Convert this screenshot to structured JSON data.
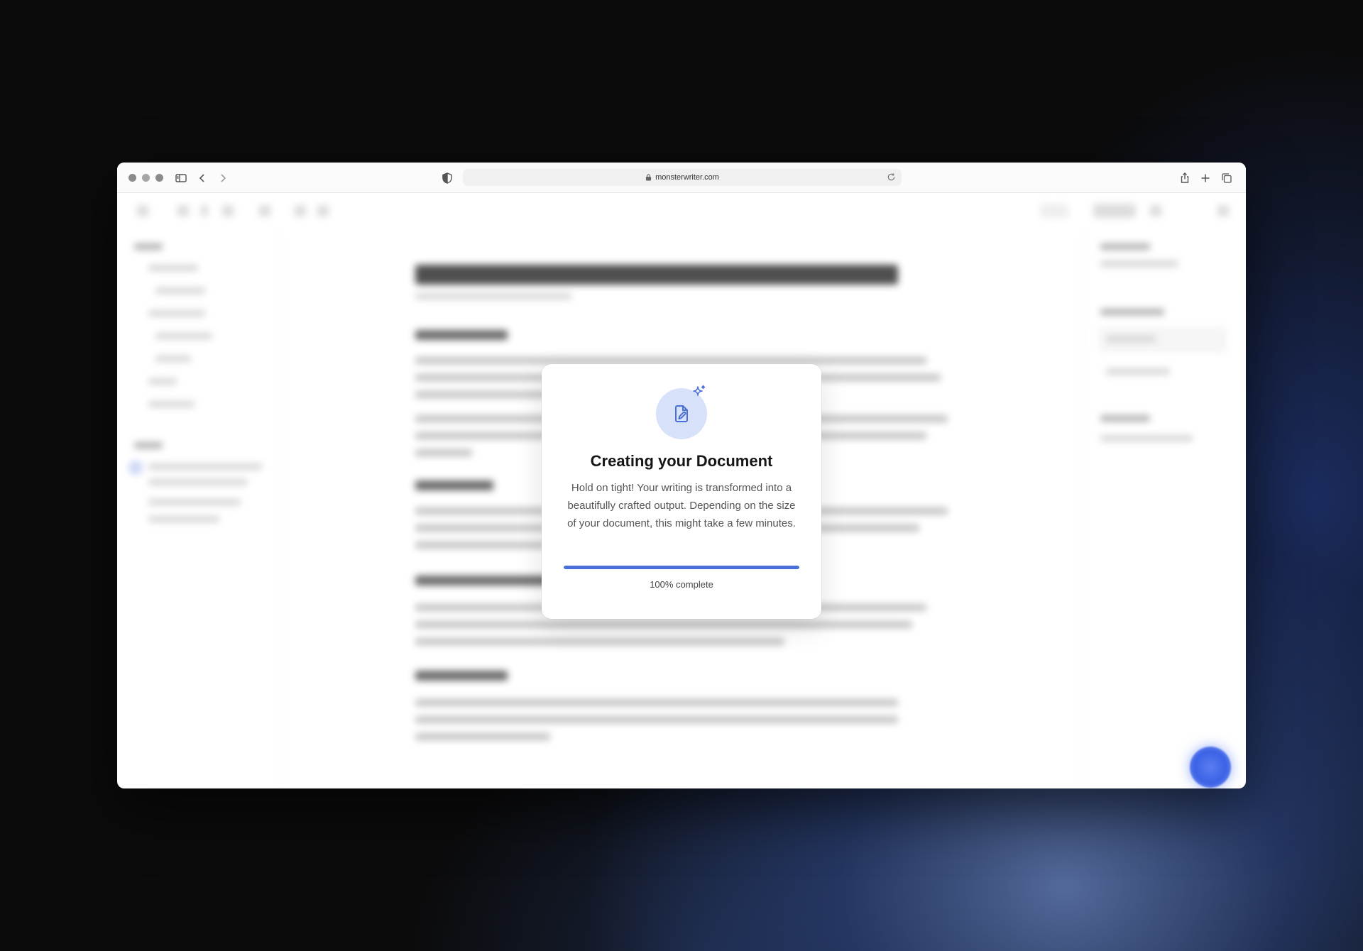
{
  "browser": {
    "url": "monsterwriter.com",
    "icons": {
      "sidebar": "sidebar-toggle-icon",
      "back": "chevron-left-icon",
      "forward": "chevron-right-icon",
      "shield": "shield-icon",
      "lock": "lock-icon",
      "reload": "reload-icon",
      "share": "share-icon",
      "new_tab": "plus-icon",
      "tabs": "tabs-overview-icon"
    }
  },
  "modal": {
    "title": "Creating your Document",
    "body": "Hold on tight! Your writing is transformed into a beautifully crafted output. Depending on the size of your document, this might take a few minutes.",
    "progress": 1.0,
    "progress_label": "100% complete",
    "accent": "#4a6fd6",
    "icon": "document-edit-icon",
    "badge_icon": "sparkle-icon"
  },
  "colors": {
    "accent": "#4a6fd6",
    "fab": "#3c62e6"
  }
}
